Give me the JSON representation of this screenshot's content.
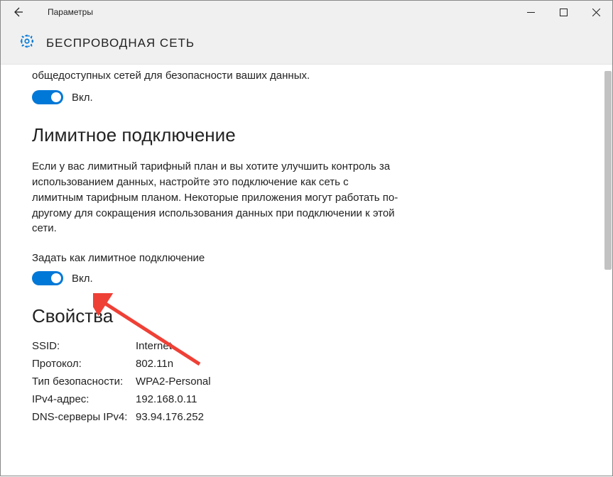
{
  "titlebar": {
    "app_title": "Параметры"
  },
  "header": {
    "page_title": "БЕСПРОВОДНАЯ СЕТЬ"
  },
  "section_public": {
    "desc_fragment": "общедоступных сетей для безопасности ваших данных.",
    "toggle_label": "Вкл."
  },
  "section_metered": {
    "title": "Лимитное подключение",
    "desc": "Если у вас лимитный тарифный план и вы хотите улучшить контроль за использованием данных, настройте это подключение как сеть с лимитным тарифным планом. Некоторые приложения могут работать по-другому для сокращения использования данных при подключении к этой сети.",
    "sub_label": "Задать как лимитное подключение",
    "toggle_label": "Вкл."
  },
  "section_props": {
    "title": "Свойства",
    "rows": [
      {
        "key": "SSID:",
        "val": "Internet"
      },
      {
        "key": "Протокол:",
        "val": "802.11n"
      },
      {
        "key": "Тип безопасности:",
        "val": "WPA2-Personal"
      },
      {
        "key": "IPv4-адрес:",
        "val": "192.168.0.11"
      },
      {
        "key": "DNS-серверы IPv4:",
        "val": "93.94.176.252"
      }
    ]
  }
}
